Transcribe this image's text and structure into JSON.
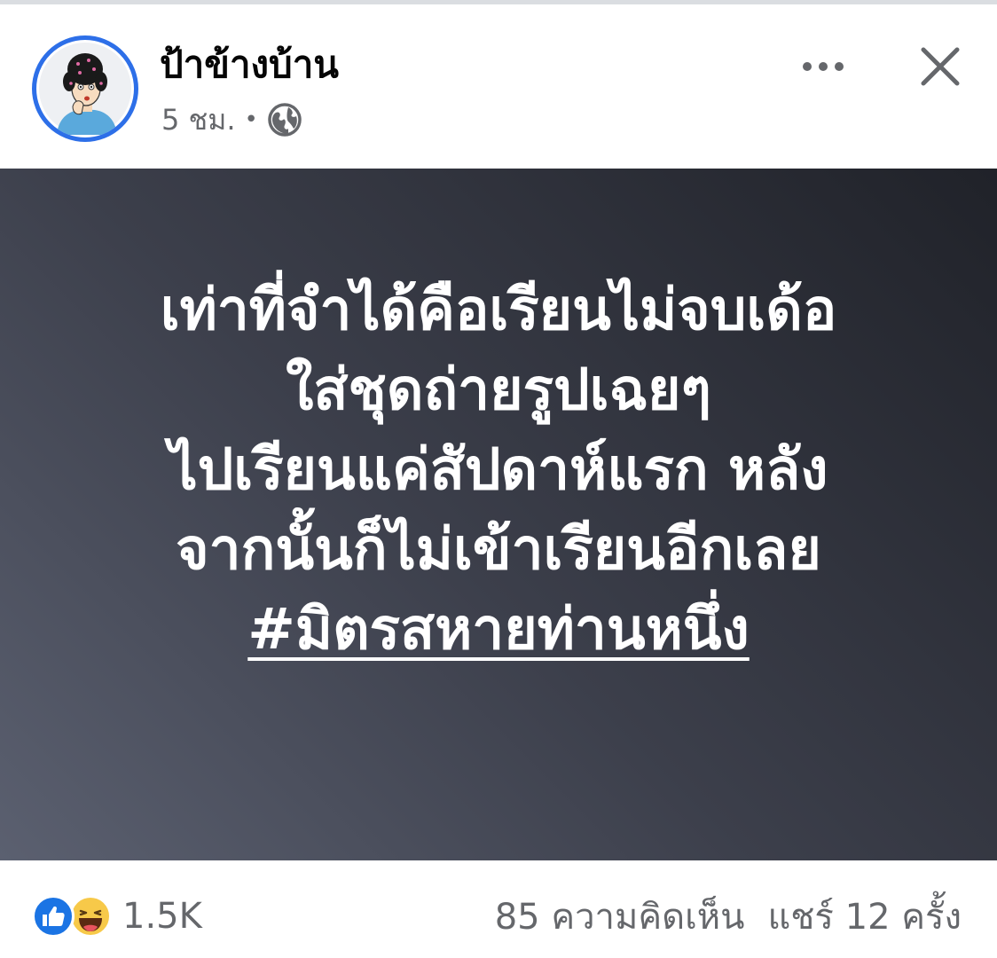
{
  "header": {
    "author_name": "ป้าข้างบ้าน",
    "timestamp": "5 ชม.",
    "separator": "•",
    "audience_icon": "globe-icon",
    "more_icon": "more-horizontal-icon",
    "close_icon": "close-icon"
  },
  "post": {
    "lines": [
      "เท่าที่จำได้คือเรียนไม่จบเด้อ",
      "ใส่ชุดถ่ายรูปเฉยๆ",
      "ไปเรียนแค่สัปดาห์แรก หลัง",
      "จากนั้นก็ไม่เข้าเรียนอีกเลย"
    ],
    "hashtag": "#มิตรสหายท่านหนึ่ง",
    "background_colors": [
      "#5b6070",
      "#202229"
    ],
    "text_color": "#ffffff"
  },
  "footer": {
    "reaction_icons": [
      "like-icon",
      "haha-icon"
    ],
    "reaction_count": "1.5K",
    "comments": "85 ความคิดเห็น",
    "shares": "แชร์ 12 ครั้ง"
  },
  "colors": {
    "accent": "#1b74e4",
    "avatar_ring": "#2d6fe8",
    "secondary_text": "#65676b"
  }
}
